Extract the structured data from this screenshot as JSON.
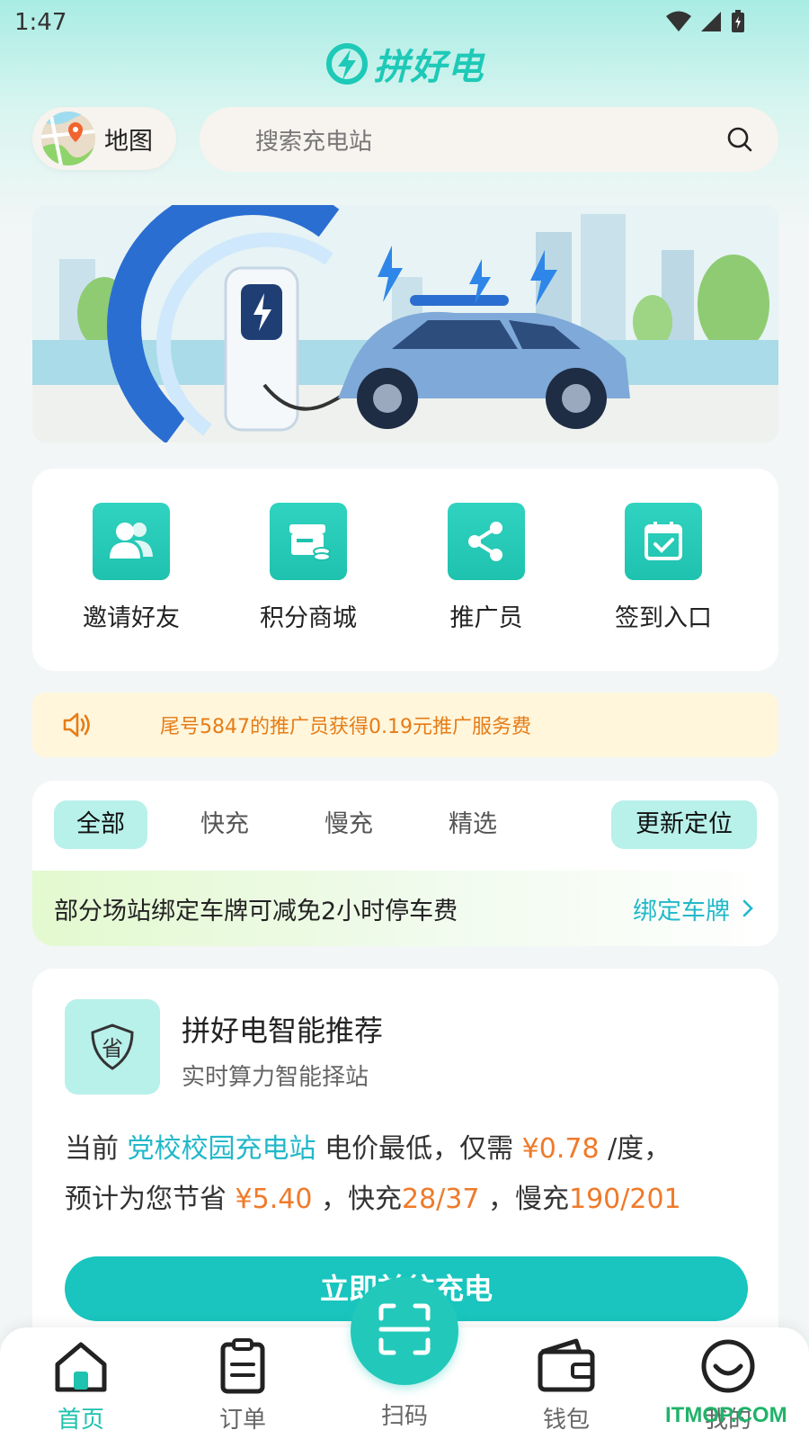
{
  "status_bar": {
    "time": "1:47"
  },
  "app": {
    "logo_text": "拼好电"
  },
  "search": {
    "map_label": "地图",
    "placeholder": "搜索充电站"
  },
  "quick_actions": [
    {
      "label": "邀请好友",
      "icon": "users-icon"
    },
    {
      "label": "积分商城",
      "icon": "store-icon"
    },
    {
      "label": "推广员",
      "icon": "share-icon"
    },
    {
      "label": "签到入口",
      "icon": "calendar-check-icon"
    }
  ],
  "notice": {
    "text": "尾号5847的推广员获得0.19元推广服务费"
  },
  "filter": {
    "tabs": [
      "全部",
      "快充",
      "慢充",
      "精选"
    ],
    "active_tab": "全部",
    "update_location": "更新定位",
    "plate_text": "部分场站绑定车牌可减免2小时停车费",
    "plate_link": "绑定车牌"
  },
  "recommend": {
    "title": "拼好电智能推荐",
    "subtitle": "实时算力智能择站",
    "line1_prefix": "当前",
    "station": "党校校园充电站",
    "line1_mid": "电价最低，仅需",
    "price": "¥0.78",
    "line1_suffix": "/度，",
    "line2_prefix": "预计为您节省",
    "saving": "¥5.40",
    "fast_label": "，快充",
    "fast_value": "28/37",
    "slow_label": "，慢充",
    "slow_value": "190/201",
    "button": "立即前往充电"
  },
  "bottom_nav": {
    "home": "首页",
    "orders": "订单",
    "scan": "扫码",
    "wallet": "钱包",
    "mine": "我的"
  },
  "watermark": "ITMOP.COM",
  "colors": {
    "accent": "#1ec2ae",
    "price": "#ef7a2a",
    "link": "#22b8c9",
    "notice_bg": "#fff6dc"
  }
}
